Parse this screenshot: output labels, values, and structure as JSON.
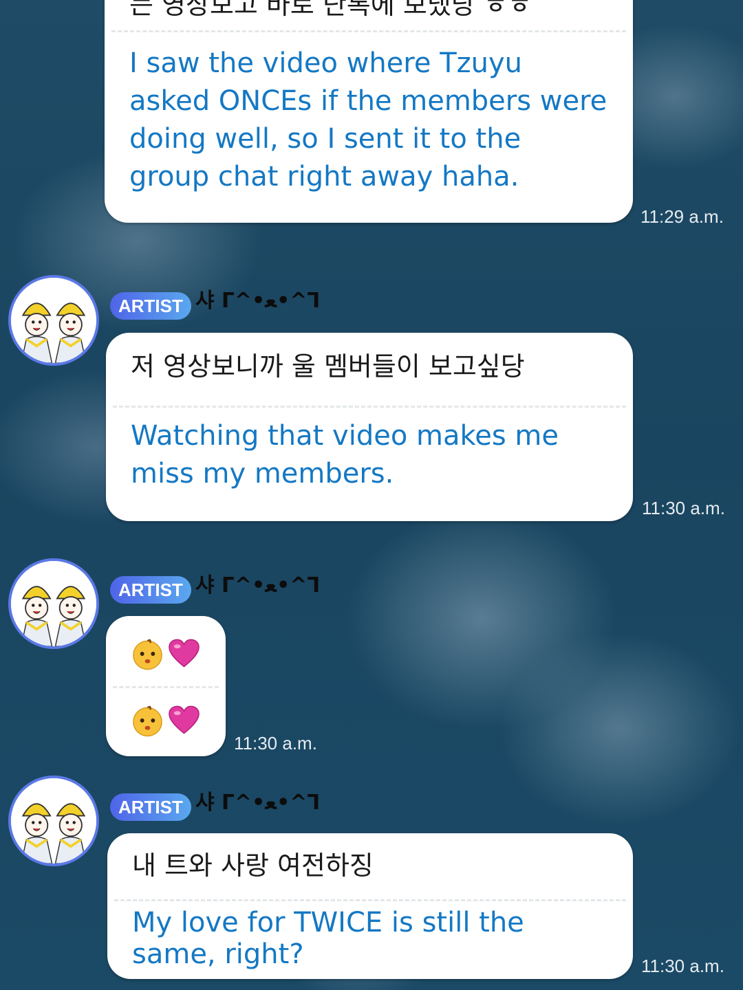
{
  "messages": [
    {
      "korean": "는 영상보고 바로 단톡에 보냈당 ㅎㅎ",
      "translation": "I saw the video where Tzuyu asked ONCEs if the members were doing well, so I sent it to the group chat right away haha.",
      "time": "11:29 a.m."
    },
    {
      "badge": "ARTIST",
      "author": "샤 ᒥ^•ﻌ•^ᒣ",
      "korean": "저 영상보니까 울 멤버들이 보고싶당",
      "translation": "Watching that video makes me miss my members.",
      "time": "11:30 a.m."
    },
    {
      "badge": "ARTIST",
      "author": "샤 ᒥ^•ﻌ•^ᒣ",
      "emoji_icons": [
        "baby-face-icon",
        "pink-heart-icon"
      ],
      "time": "11:30 a.m."
    },
    {
      "badge": "ARTIST",
      "author": "샤 ᒥ^•ﻌ•^ᒣ",
      "korean": "내 트와 사랑 여전하징",
      "translation": "My love for TWICE is still the same, right?",
      "time": "11:30 a.m."
    }
  ],
  "colors": {
    "background": "#1b4a66",
    "translation_text": "#1478c4",
    "badge_start": "#4f64e8",
    "badge_end": "#5aa8ee",
    "avatar_ring": "#5b78e6"
  }
}
